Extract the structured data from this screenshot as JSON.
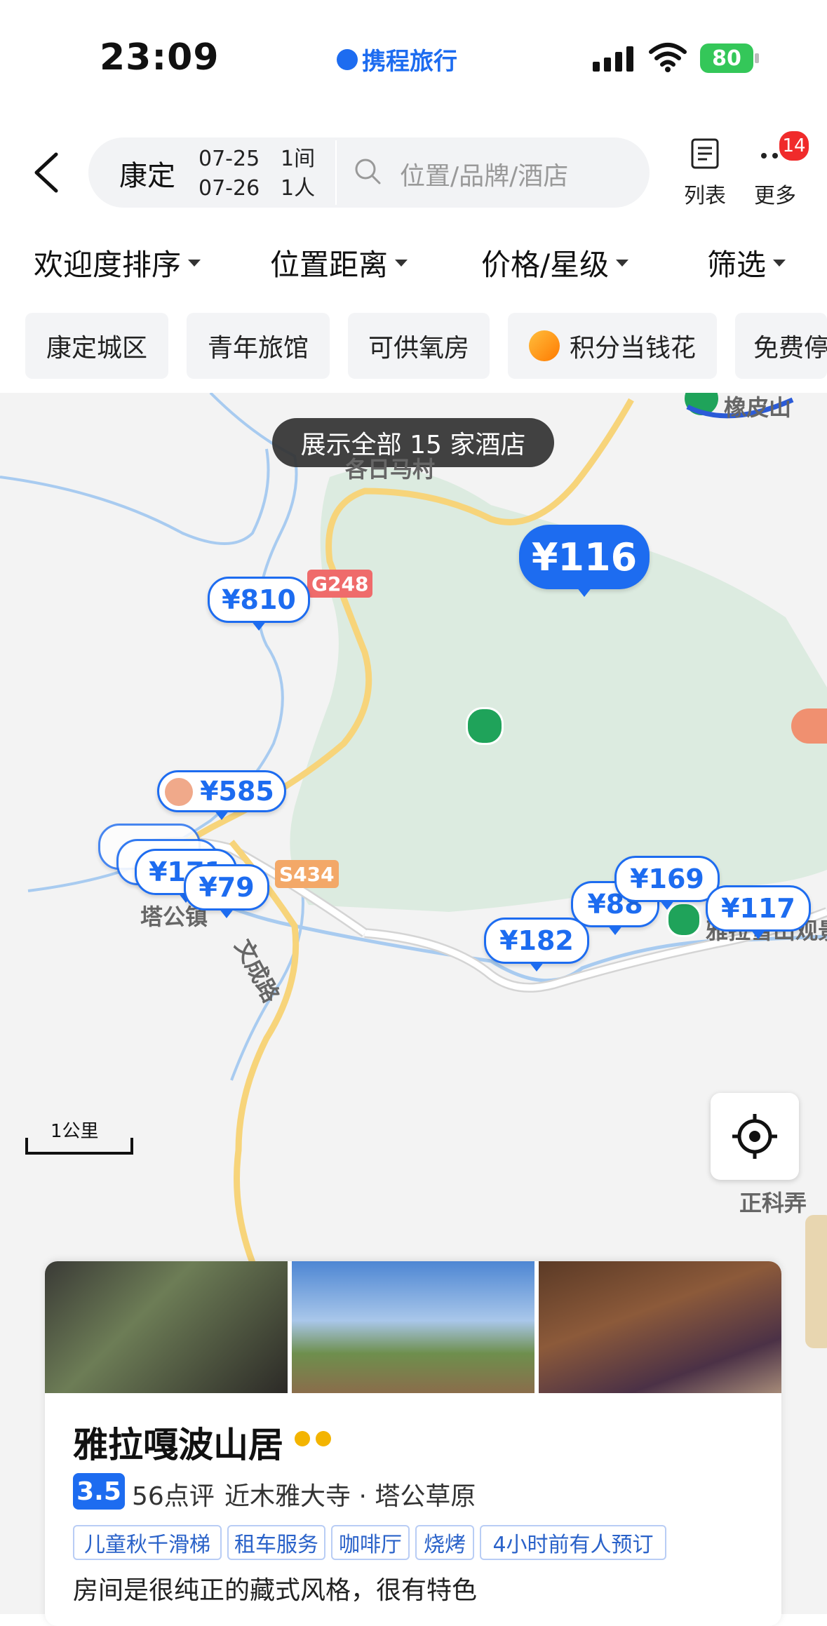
{
  "status_bar": {
    "time": "23:09",
    "brand": "携程旅行",
    "battery": "80"
  },
  "header": {
    "city": "康定",
    "checkin": "07-25",
    "checkout": "07-26",
    "rooms": "1间",
    "guests": "1人",
    "search_placeholder": "位置/品牌/酒店",
    "list_label": "列表",
    "more_label": "更多",
    "more_badge": "14"
  },
  "sort_bar": [
    "欢迎度排序",
    "位置距离",
    "价格/星级",
    "筛选"
  ],
  "chips": [
    "康定城区",
    "青年旅馆",
    "可供氧房",
    "积分当钱花",
    "免费停"
  ],
  "map": {
    "toast": "展示全部 15 家酒店",
    "places": [
      "橡皮山",
      "各日马村",
      "塔公镇",
      "文成路",
      "正科弄",
      "雅拉雪山观景"
    ],
    "roads": [
      "G248",
      "S434"
    ],
    "scale": "1公里",
    "selected_price": "¥116",
    "prices": [
      "¥810",
      "¥585",
      "¥171",
      "¥79",
      "¥88",
      "¥169",
      "¥117",
      "¥182"
    ],
    "colors": {
      "accent": "#1d6cf0",
      "green_area": "#dcebe0",
      "road": "#f7d47a",
      "river": "#a8cbf0"
    }
  },
  "hotel": {
    "name": "雅拉嘎波山居",
    "score": "3.5",
    "reviews": "56点评",
    "location": "近木雅大寺 · 塔公草原",
    "tags": [
      "儿童秋千滑梯",
      "租车服务",
      "咖啡厅",
      "烧烤",
      "4小时前有人预订"
    ],
    "quote": "房间是很纯正的藏式风格，很有特色"
  }
}
